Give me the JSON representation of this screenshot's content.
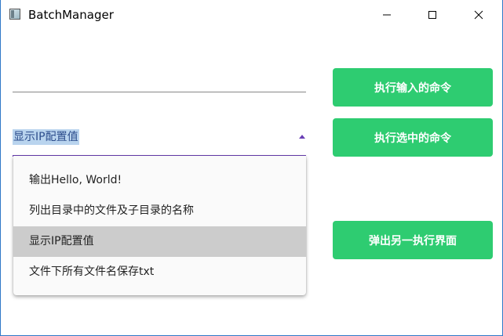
{
  "window": {
    "title": "BatchManager",
    "controls": {
      "minimize_icon": "minimize-icon",
      "maximize_icon": "maximize-icon",
      "close_icon": "close-icon"
    }
  },
  "command_input": {
    "value": ""
  },
  "command_combo": {
    "selected_value": "显示IP配置值",
    "accent_color": "#6a3fb5",
    "options": [
      "输出Hello, World!",
      "列出目录中的文件及子目录的名称",
      "显示IP配置值",
      "文件下所有文件名保存txt"
    ],
    "highlighted_index": 2
  },
  "buttons": {
    "run_input_label": "执行输入的命令",
    "run_selected_label": "执行选中的命令",
    "open_window_label": "弹出另一执行界面",
    "color": "#2ecc71"
  }
}
